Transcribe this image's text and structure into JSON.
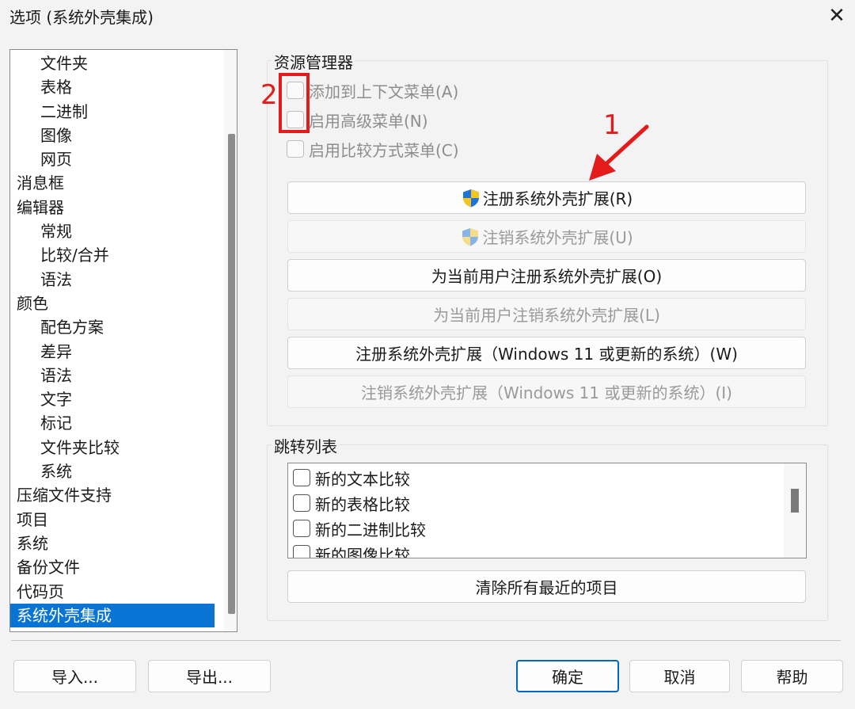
{
  "window": {
    "title": "选项 (系统外壳集成)",
    "close_glyph": "✕"
  },
  "sidebar": {
    "items": [
      {
        "label": "文件夹",
        "level": 2
      },
      {
        "label": "表格",
        "level": 2
      },
      {
        "label": "二进制",
        "level": 2
      },
      {
        "label": "图像",
        "level": 2
      },
      {
        "label": "网页",
        "level": 2
      },
      {
        "label": "消息框",
        "level": 1
      },
      {
        "label": "编辑器",
        "level": 1
      },
      {
        "label": "常规",
        "level": 2
      },
      {
        "label": "比较/合并",
        "level": 2
      },
      {
        "label": "语法",
        "level": 2
      },
      {
        "label": "颜色",
        "level": 1
      },
      {
        "label": "配色方案",
        "level": 2
      },
      {
        "label": "差异",
        "level": 2
      },
      {
        "label": "语法",
        "level": 2
      },
      {
        "label": "文字",
        "level": 2
      },
      {
        "label": "标记",
        "level": 2
      },
      {
        "label": "文件夹比较",
        "level": 2
      },
      {
        "label": "系统",
        "level": 2
      },
      {
        "label": "压缩文件支持",
        "level": 1
      },
      {
        "label": "项目",
        "level": 1
      },
      {
        "label": "系统",
        "level": 1
      },
      {
        "label": "备份文件",
        "level": 1
      },
      {
        "label": "代码页",
        "level": 1
      },
      {
        "label": "系统外壳集成",
        "level": 1,
        "selected": true
      }
    ]
  },
  "explorer": {
    "label": "资源管理器",
    "checkboxes": [
      {
        "label": "添加到上下文菜单(A)",
        "checked": false,
        "enabled": false
      },
      {
        "label": "启用高级菜单(N)",
        "checked": false,
        "enabled": false
      },
      {
        "label": "启用比较方式菜单(C)",
        "checked": false,
        "enabled": false
      }
    ],
    "buttons": [
      {
        "label": "注册系统外壳扩展(R)",
        "enabled": true,
        "icon": "uac-shield-icon"
      },
      {
        "label": "注销系统外壳扩展(U)",
        "enabled": false,
        "icon": "uac-shield-icon"
      },
      {
        "label": "为当前用户注册系统外壳扩展(O)",
        "enabled": true
      },
      {
        "label": "为当前用户注销系统外壳扩展(L)",
        "enabled": false
      },
      {
        "label": "注册系统外壳扩展（Windows 11 或更新的系统）(W)",
        "enabled": true
      },
      {
        "label": "注销系统外壳扩展（Windows 11 或更新的系统）(I)",
        "enabled": false
      }
    ]
  },
  "jumplist": {
    "label": "跳转列表",
    "items": [
      {
        "label": "新的文本比较",
        "checked": false
      },
      {
        "label": "新的表格比较",
        "checked": false
      },
      {
        "label": "新的二进制比较",
        "checked": false
      },
      {
        "label": "新的图像比较",
        "checked": false
      }
    ],
    "clear_label": "清除所有最近的项目"
  },
  "footer": {
    "import_label": "导入...",
    "export_label": "导出...",
    "ok_label": "确定",
    "cancel_label": "取消",
    "help_label": "帮助"
  },
  "annotations": {
    "one": "1",
    "two": "2"
  },
  "colors": {
    "selection": "#0a74d4",
    "annotation": "#e41b1b",
    "default_button_border": "#0067c0"
  }
}
